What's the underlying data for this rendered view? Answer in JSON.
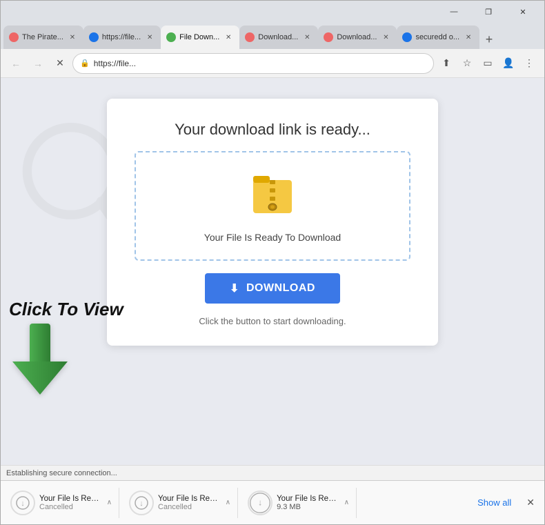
{
  "window": {
    "title_bar": {
      "minimize_label": "—",
      "restore_label": "❐",
      "close_label": "✕"
    }
  },
  "tabs": [
    {
      "id": "tab1",
      "favicon_color": "#e66",
      "title": "The Pirate...",
      "active": false
    },
    {
      "id": "tab2",
      "favicon_color": "#1a73e8",
      "title": "https://file...",
      "active": false
    },
    {
      "id": "tab3",
      "favicon_color": "#4caf50",
      "title": "File Down...",
      "active": true
    },
    {
      "id": "tab4",
      "favicon_color": "#e66",
      "title": "Download...",
      "active": false
    },
    {
      "id": "tab5",
      "favicon_color": "#e66",
      "title": "Download...",
      "active": false
    },
    {
      "id": "tab6",
      "favicon_color": "#1a73e8",
      "title": "securedd o...",
      "active": false
    }
  ],
  "nav": {
    "address": "https://file...",
    "back_label": "←",
    "forward_label": "→",
    "close_label": "✕",
    "lock_icon": "🔒"
  },
  "page": {
    "card_title": "Your download link is ready...",
    "file_label": "Your File Is Ready To Download",
    "download_btn_label": "DOWNLOAD",
    "hint_text": "Click the button to start downloading."
  },
  "annotation": {
    "click_to_view": "Click To View"
  },
  "status_bar": {
    "text": "Establishing secure connection..."
  },
  "downloads": [
    {
      "filename": "Your File Is Ready....vhd",
      "status": "Cancelled",
      "size": ""
    },
    {
      "filename": "Your File Is Ready....vhd",
      "status": "Cancelled",
      "size": ""
    },
    {
      "filename": "Your File Is Ready....vhd",
      "status": "9.3 MB",
      "size": "9.3 MB"
    }
  ],
  "downloads_bar": {
    "show_all_label": "Show all",
    "close_label": "✕"
  }
}
